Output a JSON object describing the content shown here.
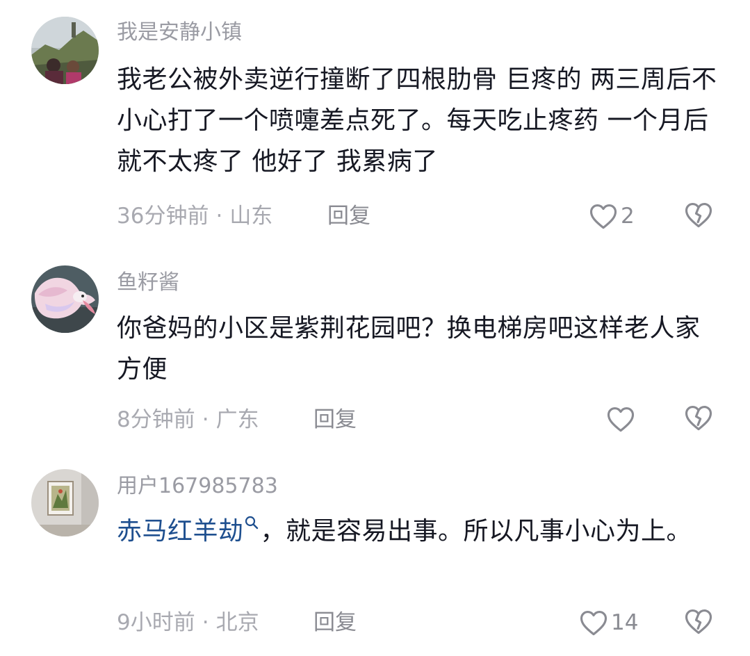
{
  "comments": [
    {
      "username": "我是安静小镇",
      "text": "我老公被外卖逆行撞断了四根肋骨 巨疼的 两三周后不小心打了一个喷嚏差点死了。每天吃止疼药  一个月后就不太疼了 他好了 我累病了",
      "time": "36分钟前",
      "location": "山东",
      "reply_label": "回复",
      "like_count": "2",
      "avatar_icon": "avatar-photo-mountain"
    },
    {
      "username": "鱼籽酱",
      "text": "你爸妈的小区是紫荆花园吧？换电梯房吧这样老人家方便",
      "time": "8分钟前",
      "location": "广东",
      "reply_label": "回复",
      "like_count": "",
      "avatar_icon": "avatar-photo-betta-fish"
    },
    {
      "username": "用户167985783",
      "hashtag": "赤马红羊劫",
      "text": "，就是容易出事。所以凡事小心为上。",
      "time": "9小时前",
      "location": "北京",
      "reply_label": "回复",
      "like_count": "14",
      "avatar_icon": "avatar-photo-painting"
    }
  ],
  "separator": "·",
  "colors": {
    "hashtag": "#1e4f8f",
    "meta": "#a8a9b0",
    "text": "#161823"
  }
}
